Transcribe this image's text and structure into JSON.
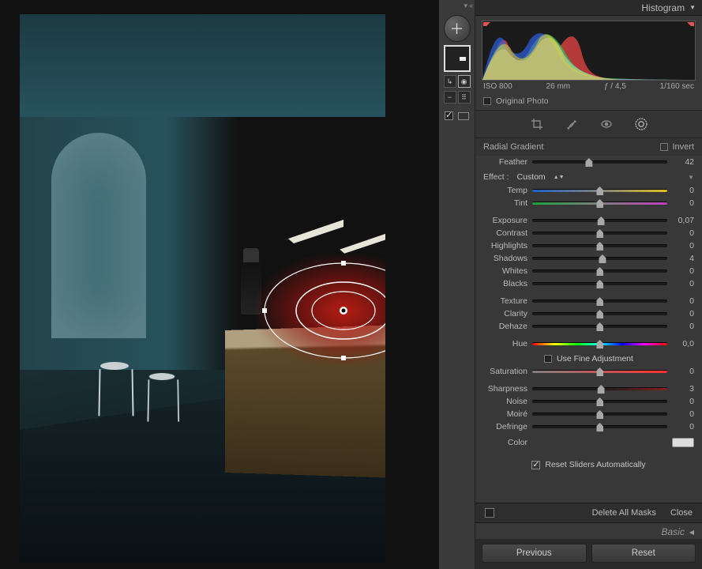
{
  "header": {
    "histogram_label": "Histogram"
  },
  "histo_info": {
    "iso": "ISO 800",
    "focal": "26 mm",
    "aperture": "ƒ / 4,5",
    "shutter": "1/160 sec"
  },
  "original_photo_label": "Original Photo",
  "gradient": {
    "title": "Radial Gradient",
    "invert_label": "Invert"
  },
  "feather": {
    "label": "Feather",
    "value": "42",
    "pos": 42
  },
  "effect": {
    "label": "Effect :",
    "value": "Custom"
  },
  "fine_adjust_label": "Use Fine Adjustment",
  "color_label": "Color",
  "auto_reset_label": "Reset Sliders Automatically",
  "footer": {
    "delete_all": "Delete All Masks",
    "close": "Close"
  },
  "basic_label": "Basic",
  "nav": {
    "prev": "Previous",
    "reset": "Reset"
  },
  "sliders": [
    {
      "key": "temp",
      "label": "Temp",
      "value": "0",
      "pos": 50,
      "cls": "temp"
    },
    {
      "key": "tint",
      "label": "Tint",
      "value": "0",
      "pos": 50,
      "cls": "tint"
    },
    {
      "gap": true
    },
    {
      "key": "exposure",
      "label": "Exposure",
      "value": "0,07",
      "pos": 51
    },
    {
      "key": "contrast",
      "label": "Contrast",
      "value": "0",
      "pos": 50
    },
    {
      "key": "highlights",
      "label": "Highlights",
      "value": "0",
      "pos": 50
    },
    {
      "key": "shadows",
      "label": "Shadows",
      "value": "4",
      "pos": 52
    },
    {
      "key": "whites",
      "label": "Whites",
      "value": "0",
      "pos": 50
    },
    {
      "key": "blacks",
      "label": "Blacks",
      "value": "0",
      "pos": 50
    },
    {
      "gap": true
    },
    {
      "key": "texture",
      "label": "Texture",
      "value": "0",
      "pos": 50
    },
    {
      "key": "clarity",
      "label": "Clarity",
      "value": "0",
      "pos": 50
    },
    {
      "key": "dehaze",
      "label": "Dehaze",
      "value": "0",
      "pos": 50
    },
    {
      "gap": true
    },
    {
      "key": "hue",
      "label": "Hue",
      "value": "0,0",
      "pos": 50,
      "cls": "hue"
    },
    {
      "fine": true
    },
    {
      "key": "saturation",
      "label": "Saturation",
      "value": "0",
      "pos": 50,
      "cls": "sat"
    },
    {
      "gap": true
    },
    {
      "key": "sharpness",
      "label": "Sharpness",
      "value": "3",
      "pos": 51,
      "cls": "sharp"
    },
    {
      "key": "noise",
      "label": "Noise",
      "value": "0",
      "pos": 50
    },
    {
      "key": "moire",
      "label": "Moiré",
      "value": "0",
      "pos": 50
    },
    {
      "key": "defringe",
      "label": "Defringe",
      "value": "0",
      "pos": 50
    }
  ]
}
